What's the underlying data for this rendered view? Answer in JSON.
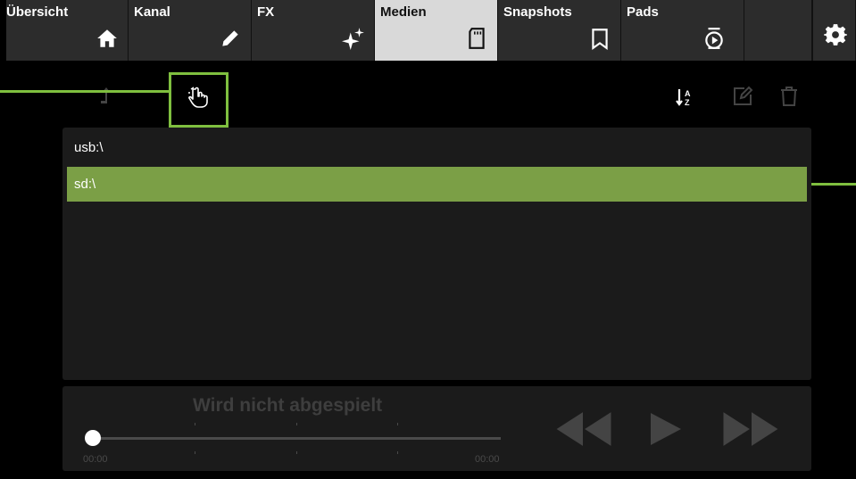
{
  "tabs": [
    {
      "label": "Übersicht",
      "icon": "home-icon"
    },
    {
      "label": "Kanal",
      "icon": "pencil-icon"
    },
    {
      "label": "FX",
      "icon": "sparkle-icon"
    },
    {
      "label": "Medien",
      "icon": "sd-card-icon",
      "active": true
    },
    {
      "label": "Snapshots",
      "icon": "bookmark-icon"
    },
    {
      "label": "Pads",
      "icon": "pads-play-icon"
    }
  ],
  "settings_icon": "gear-icon",
  "toolbar": {
    "up_icon": "folder-up-icon",
    "touch_icon": "touch-hand-icon",
    "sort_icon": "sort-az-icon",
    "edit_icon": "edit-icon",
    "delete_icon": "trash-icon",
    "highlight_color": "#7fbf3f"
  },
  "files": [
    {
      "name": "usb:\\",
      "selected": false
    },
    {
      "name": "sd:\\",
      "selected": true
    }
  ],
  "selection_color": "#7b9f46",
  "player": {
    "status": "Wird nicht abgespielt",
    "time_start": "00:00",
    "time_end": "00:00",
    "progress": 0,
    "rewind_icon": "rewind-icon",
    "play_icon": "play-icon",
    "forward_icon": "fast-forward-icon"
  }
}
